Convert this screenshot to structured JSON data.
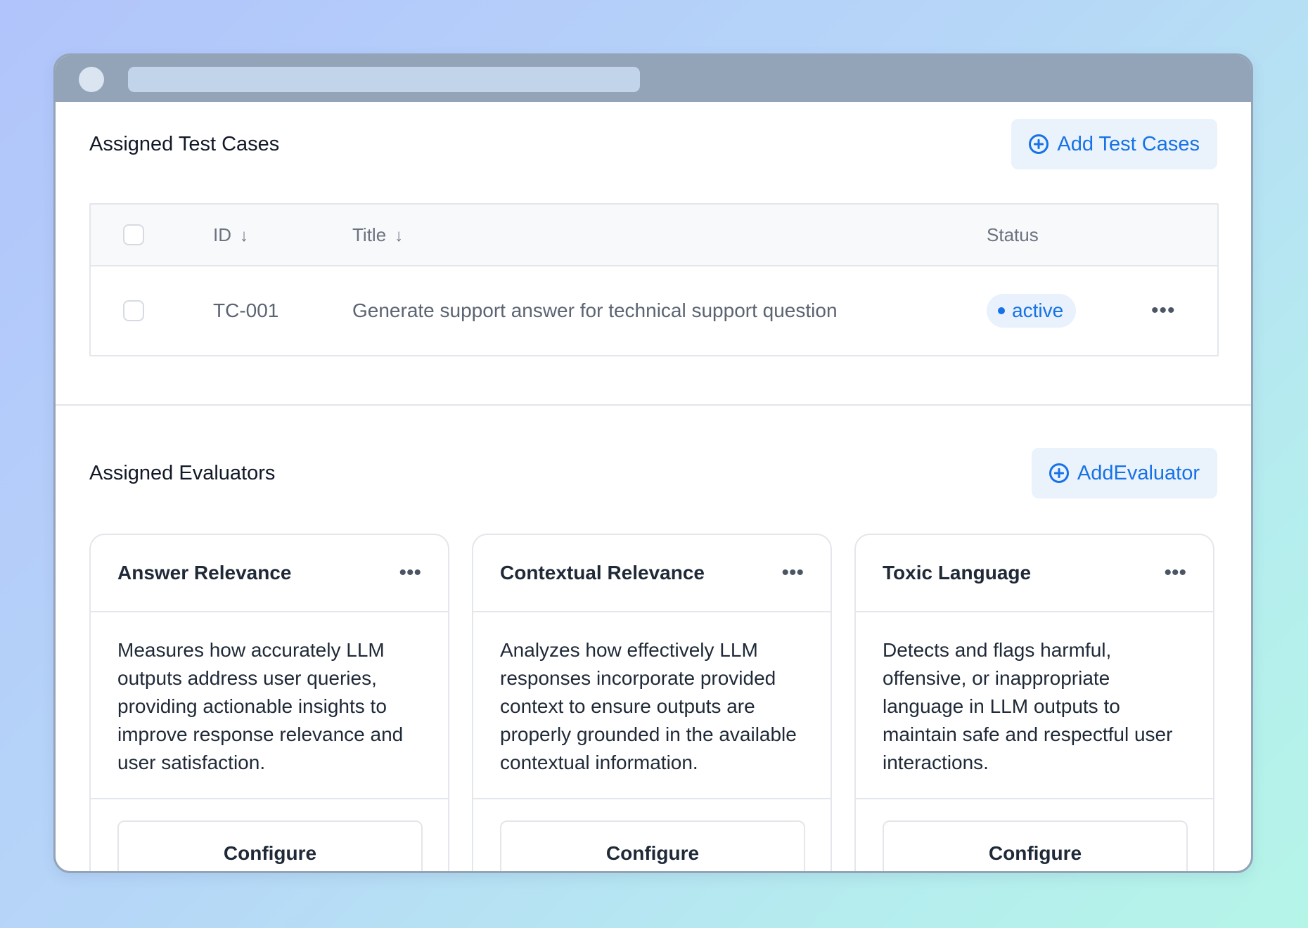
{
  "test_cases": {
    "title": "Assigned Test Cases",
    "add_label": "Add Test Cases",
    "columns": {
      "id": "ID",
      "title": "Title",
      "status": "Status"
    },
    "rows": [
      {
        "id": "TC-001",
        "title": "Generate support answer for technical support question",
        "status": "active"
      }
    ]
  },
  "evaluators": {
    "title": "Assigned Evaluators",
    "add_label": "AddEvaluator",
    "cards": [
      {
        "title": "Answer Relevance",
        "description": "Measures how accurately LLM outputs address user queries, providing actionable insights to improve response relevance and user satisfaction.",
        "button": "Configure"
      },
      {
        "title": "Contextual Relevance",
        "description": "Analyzes how effectively LLM responses incorporate provided context to ensure outputs are properly grounded in the available contextual information.",
        "button": "Configure"
      },
      {
        "title": "Toxic Language",
        "description": "Detects and flags harmful, offensive, or inappropriate language in LLM outputs to maintain safe and respectful user interactions.",
        "button": "Configure"
      }
    ]
  },
  "icons": {
    "add": "plus-circle-icon",
    "sort": "arrow-down-icon",
    "menu": "more-horizontal-icon"
  },
  "colors": {
    "accent": "#1672e6",
    "accent_bg": "#eaf2fc",
    "window_chrome": "#93a3b8"
  }
}
